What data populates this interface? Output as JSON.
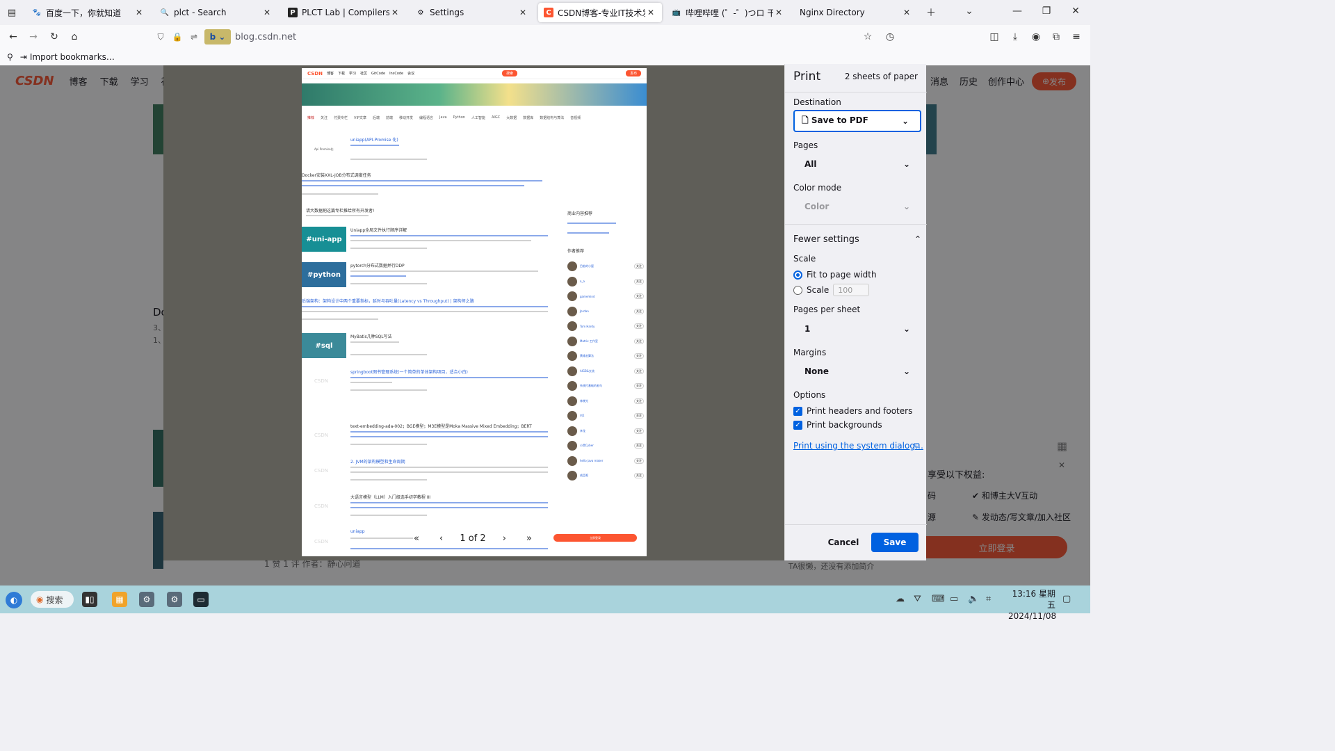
{
  "tabs": [
    {
      "title": "百度一下，你就知道",
      "icon": "baidu-icon",
      "color": "#2932e1"
    },
    {
      "title": "plct - Search",
      "icon": "search-icon",
      "color": "#555555"
    },
    {
      "title": "PLCT Lab | Compilers, Runtimes",
      "icon": "plct-icon",
      "color": "#222222"
    },
    {
      "title": "Settings",
      "icon": "gear-icon",
      "color": "#555555"
    },
    {
      "title": "CSDN博客-专业IT技术发表平台",
      "icon": "csdn-icon",
      "color": "#fc5531",
      "active": true
    },
    {
      "title": "哔哩哔哩 (゜-゜)つロ 干杯~-bilibili",
      "icon": "bilibili-icon",
      "color": "#00a1d6"
    },
    {
      "title": "Nginx Directory",
      "icon": "",
      "color": ""
    }
  ],
  "nav": {
    "url": "blog.csdn.net",
    "bookmarks_import": "Import bookmarks…"
  },
  "page": {
    "logo": "CSDN",
    "nav_items": [
      "博客",
      "下载",
      "学习",
      "社区"
    ],
    "right_items": [
      "消息",
      "历史",
      "创作中心"
    ],
    "publish": "发布",
    "side_benefits_title": "享受以下权益:",
    "benefit_1": "和博主大V互动",
    "benefit_2": "发动态/写文章/加入社区",
    "benefit_frag_1": "码",
    "benefit_frag_2": "源",
    "login": "立即登录",
    "author_note": "TA很懒，还没有添加简介",
    "bottom_meta": "1 赞   1 评   作者：静心问道",
    "left_frag_1": "Do",
    "left_frag_2": "3、",
    "left_frag_3": "1、"
  },
  "preview": {
    "mini_nav": [
      "博客",
      "下载",
      "学习",
      "社区",
      "GitCode",
      "InsCode",
      "会议"
    ],
    "mini_search": "搜索",
    "mini_publish": "发布",
    "mini_cats": [
      "推荐",
      "关注",
      "付费专栏",
      "VIP文章",
      "后端",
      "前端",
      "移动开发",
      "编程语言",
      "Java",
      "Python",
      "人工智能",
      "AIGC",
      "大数据",
      "数据库",
      "数据结构与算法",
      "音视频"
    ],
    "articles": [
      {
        "title": "uniapp(API-Promise 化)",
        "tag": "Api Promise化",
        "tag_color": ""
      },
      {
        "title": "Docker安装XXL-JOB分布式调度任务",
        "tag": "",
        "tag_color": ""
      },
      {
        "title": "请大数据把这篇专栏推给所有开发者!",
        "tag": "",
        "tag_color": ""
      },
      {
        "title": "Uniapp全局文件执行顺序详解",
        "tag": "#uni-app",
        "tag_color": "#178f95"
      },
      {
        "title": "pytorch分布式数据并行DDP",
        "tag": "#python",
        "tag_color": "#2d6e9c"
      },
      {
        "title": "后端架构：架构设计中两个重要指标，延时与吞吐量(Latency vs Throughput) | 架构师之路",
        "tag": "",
        "tag_color": ""
      },
      {
        "title": "MyBatis几种SQL写法",
        "tag": "#sql",
        "tag_color": "#3b8a99"
      },
      {
        "title": "springboot图书管理系统(一个简单的单体架构项目，适合小白)",
        "tag": "",
        "tag_color": ""
      },
      {
        "title": "text-embedding-ada-002；BGE模型；M3E模型是Moka Massive Mixed Embedding；BERT",
        "tag": "",
        "tag_color": ""
      },
      {
        "title": "2. JVM的架构模型和生命周期",
        "tag": "",
        "tag_color": ""
      },
      {
        "title": "大语言模型（LLM）入门级选手初学教程 III",
        "tag": "",
        "tag_color": ""
      },
      {
        "title": "uniapp",
        "tag": "",
        "tag_color": ""
      }
    ],
    "right_title_1": "商业内容推荐",
    "right_title_2": "作者推荐",
    "authors": [
      "目若的小屋",
      "a_a",
      "gamemind",
      "Jordan",
      "Tom Hardy",
      "Matrix 工作室",
      "黄维宏算法",
      "AIGB&交流",
      "系统打基础的老鸟",
      "林晓光",
      "刘1",
      "李龙",
      "小黑Cyber",
      "hello java maker",
      "成品呢"
    ],
    "page_indicator": "1 of 2",
    "login_btn": "立即登录"
  },
  "print": {
    "title": "Print",
    "sheets": "2 sheets of paper",
    "destination_label": "Destination",
    "destination_value": "Save to PDF",
    "pages_label": "Pages",
    "pages_value": "All",
    "color_label": "Color mode",
    "color_value": "Color",
    "fewer_settings": "Fewer settings",
    "scale_label": "Scale",
    "fit_label": "Fit to page width",
    "scale_option": "Scale",
    "scale_value": "100",
    "pps_label": "Pages per sheet",
    "pps_value": "1",
    "margins_label": "Margins",
    "margins_value": "None",
    "options_label": "Options",
    "opt_headers": "Print headers and footers",
    "opt_backgrounds": "Print backgrounds",
    "system_dialog": "Print using the system dialog…",
    "cancel": "Cancel",
    "save": "Save"
  },
  "taskbar": {
    "search": "搜索",
    "time": "13:16 星期五",
    "date": "2024/11/08"
  },
  "colors": {
    "accent": "#0061e0",
    "csdn_red": "#fc5531",
    "taskbar": "#a9d3dc"
  }
}
